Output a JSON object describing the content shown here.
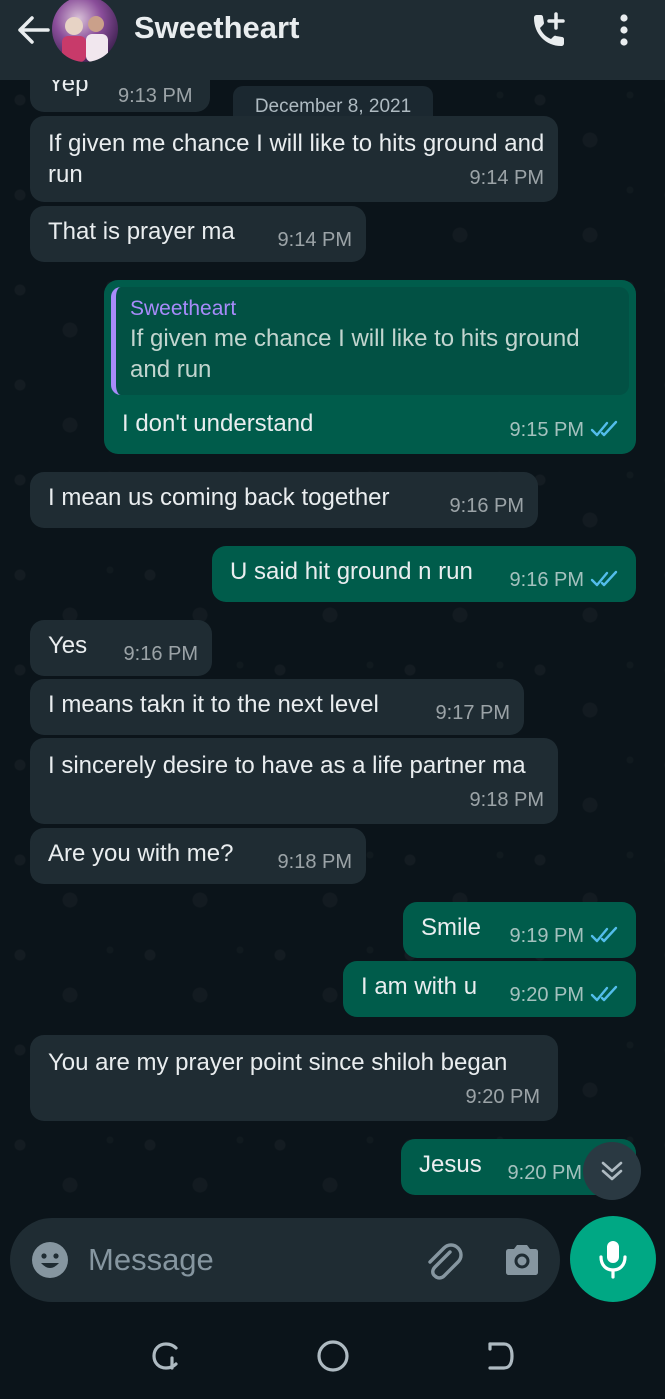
{
  "header": {
    "contact_name": "Sweetheart"
  },
  "date_chip": "December 8, 2021",
  "messages": [
    {
      "dir": "in",
      "text": "Yep",
      "time": "9:13 PM"
    },
    {
      "dir": "in",
      "text": "If given me chance I will like to hits ground and run",
      "time": "9:14 PM"
    },
    {
      "dir": "in",
      "text": "That is prayer ma",
      "time": "9:14 PM"
    },
    {
      "dir": "out",
      "quote_author": "Sweetheart",
      "quote_text": "If given me chance I will like to hits ground and run",
      "text": "I don't understand",
      "time": "9:15 PM"
    },
    {
      "dir": "in",
      "text": "I mean us coming back together",
      "time": "9:16 PM"
    },
    {
      "dir": "out",
      "text": "U said hit ground n run",
      "time": "9:16 PM"
    },
    {
      "dir": "in",
      "text": "Yes",
      "time": "9:16 PM"
    },
    {
      "dir": "in",
      "text": "I means takn it to the next level",
      "time": "9:17 PM"
    },
    {
      "dir": "in",
      "text": "I sincerely desire to have as a life partner ma",
      "time": "9:18 PM"
    },
    {
      "dir": "in",
      "text": "Are you with me?",
      "time": "9:18 PM"
    },
    {
      "dir": "out",
      "text": "Smile",
      "time": "9:19 PM"
    },
    {
      "dir": "out",
      "text": "I am with u",
      "time": "9:20 PM"
    },
    {
      "dir": "in",
      "text": "You are my prayer point since shiloh began",
      "time": "9:20 PM"
    },
    {
      "dir": "out",
      "text": "Jesus",
      "time": "9:20 PM"
    }
  ],
  "composer": {
    "placeholder": "Message"
  },
  "icons": {
    "back": "arrow-left-icon",
    "call": "add-call-icon",
    "menu": "more-vert-icon",
    "emoji": "emoji-icon",
    "attach": "paperclip-icon",
    "camera": "camera-icon",
    "mic": "mic-icon",
    "scroll": "double-chevron-down-icon",
    "read_ticks": "double-check-icon"
  },
  "colors": {
    "incoming_bubble": "#1f2c33",
    "outgoing_bubble": "#005c4b",
    "accent": "#00a884",
    "read_ticks": "#53bdeb",
    "quote_author": "#a78bfa"
  }
}
